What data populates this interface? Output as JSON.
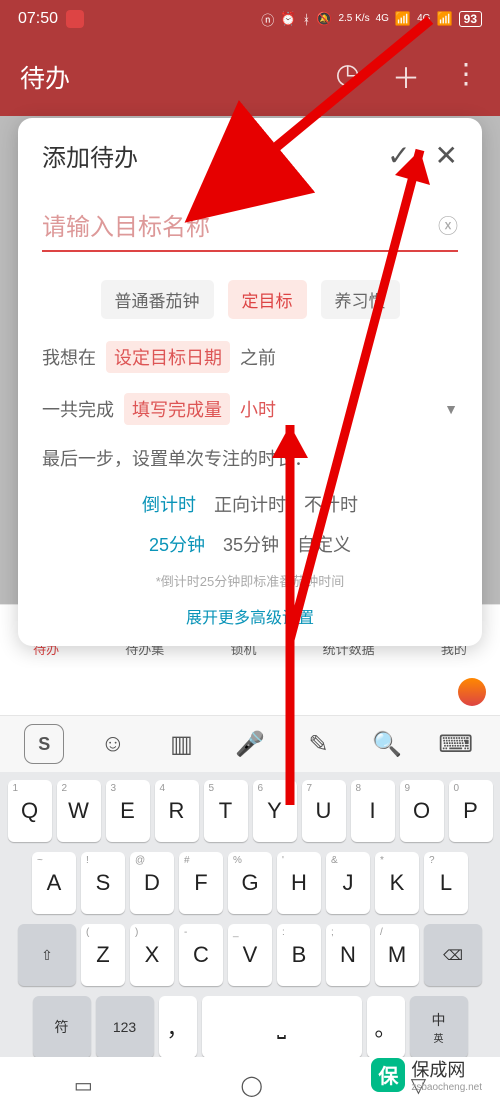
{
  "status": {
    "time": "07:50",
    "net_speed": "2.5 K/s",
    "sig1": "4G",
    "sig2": "4G",
    "battery": "93"
  },
  "header": {
    "title": "待办"
  },
  "dialog": {
    "title": "添加待办",
    "placeholder": "请输入目标名称",
    "types": [
      "普通番茄钟",
      "定目标",
      "养习惯"
    ],
    "line1_a": "我想在",
    "line1_token": "设定目标日期",
    "line1_b": "之前",
    "line2_a": "一共完成",
    "line2_token": "填写完成量",
    "line2_unit": "小时",
    "line3": "最后一步，设置单次专注的时长：",
    "timer_modes": [
      "倒计时",
      "正向计时",
      "不计时"
    ],
    "durations": [
      "25分钟",
      "35分钟",
      "自定义"
    ],
    "hint": "*倒计时25分钟即标准番茄钟时间",
    "expand": "展开更多高级设置"
  },
  "nav": {
    "items": [
      {
        "label": "待办"
      },
      {
        "label": "待办集"
      },
      {
        "label": "锁机"
      },
      {
        "label": "统计数据"
      },
      {
        "label": "我的"
      }
    ]
  },
  "keyboard": {
    "row1": [
      {
        "m": "Q",
        "s": "1"
      },
      {
        "m": "W",
        "s": "2"
      },
      {
        "m": "E",
        "s": "3"
      },
      {
        "m": "R",
        "s": "4"
      },
      {
        "m": "T",
        "s": "5"
      },
      {
        "m": "Y",
        "s": "6"
      },
      {
        "m": "U",
        "s": "7"
      },
      {
        "m": "I",
        "s": "8"
      },
      {
        "m": "O",
        "s": "9"
      },
      {
        "m": "P",
        "s": "0"
      }
    ],
    "row2": [
      {
        "m": "A",
        "s": "~"
      },
      {
        "m": "S",
        "s": "!"
      },
      {
        "m": "D",
        "s": "@"
      },
      {
        "m": "F",
        "s": "#"
      },
      {
        "m": "G",
        "s": "%"
      },
      {
        "m": "H",
        "s": "'"
      },
      {
        "m": "J",
        "s": "&"
      },
      {
        "m": "K",
        "s": "*"
      },
      {
        "m": "L",
        "s": "?"
      }
    ],
    "row3": [
      {
        "m": "Z",
        "s": "("
      },
      {
        "m": "X",
        "s": ")"
      },
      {
        "m": "C",
        "s": "-"
      },
      {
        "m": "V",
        "s": "_"
      },
      {
        "m": "B",
        "s": ":"
      },
      {
        "m": "N",
        "s": ";"
      },
      {
        "m": "M",
        "s": "/"
      }
    ],
    "fn": {
      "sym": "符",
      "num": "123",
      "comma": "，",
      "period": "。",
      "lang_main": "中",
      "lang_sub": "英"
    }
  },
  "watermark": {
    "text": "保成网",
    "sub": "zsbaocheng.net"
  }
}
